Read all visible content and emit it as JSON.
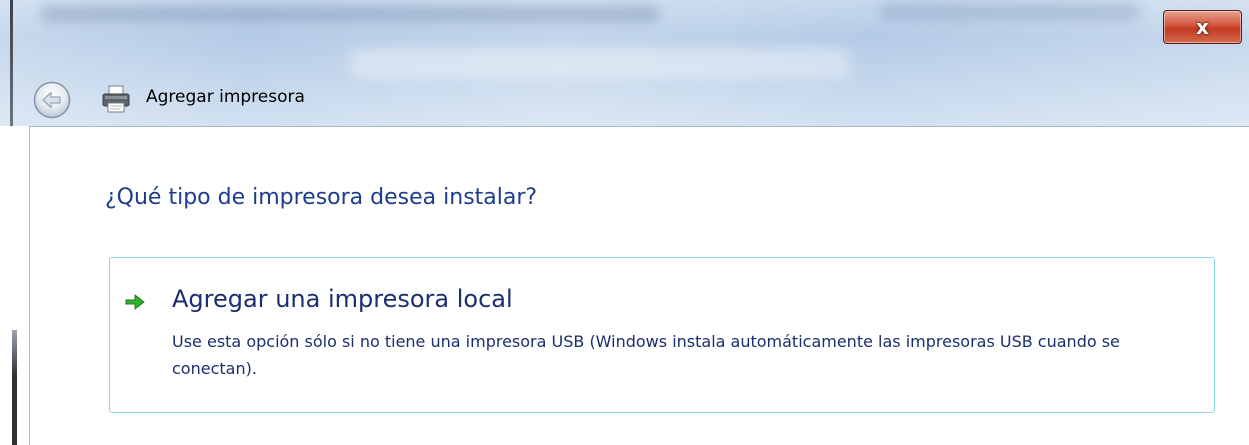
{
  "window": {
    "title": "Agregar impresora",
    "close_glyph": "x",
    "accent_color": "#1e3c8c",
    "close_color": "#c23a22"
  },
  "icons": {
    "back": "back-arrow-icon",
    "printer": "printer-icon",
    "option_arrow": "green-arrow-icon"
  },
  "main": {
    "heading": "¿Qué tipo de impresora desea instalar?",
    "options": [
      {
        "title": "Agregar una impresora local",
        "description": "Use esta opción sólo si no tiene una impresora USB (Windows instala automáticamente las impresoras USB cuando se conectan)."
      }
    ]
  }
}
